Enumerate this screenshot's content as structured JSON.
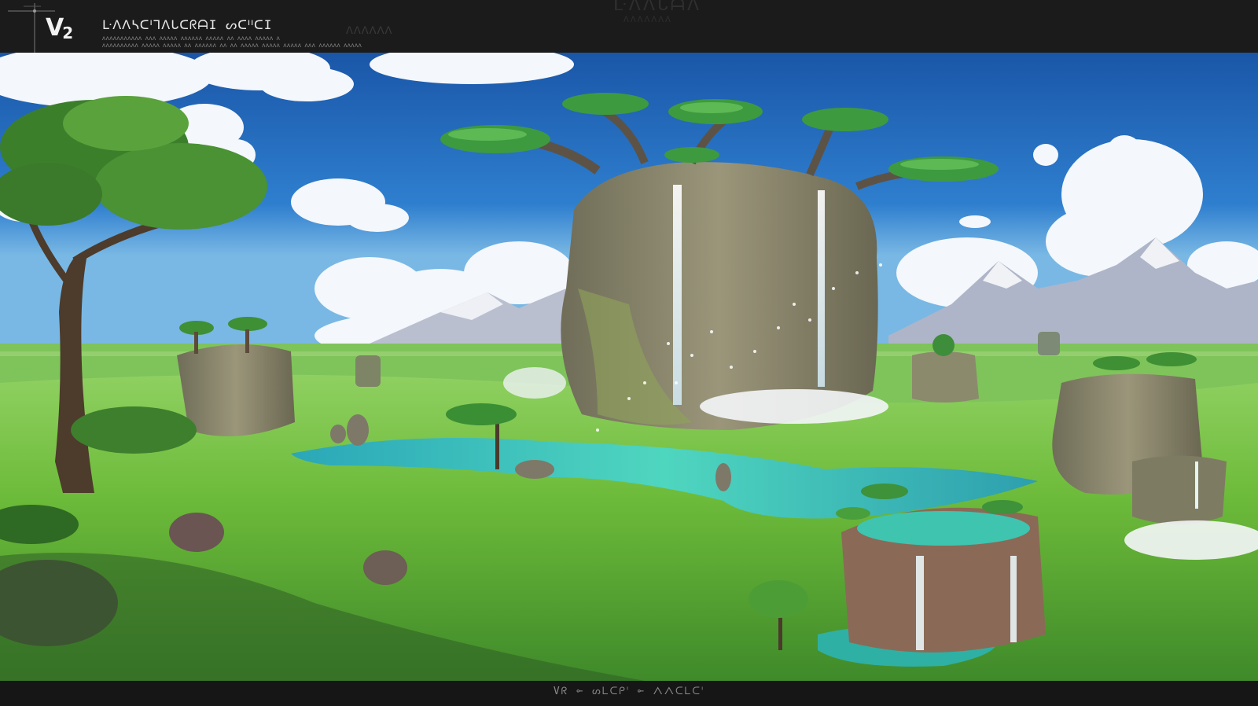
{
  "header": {
    "logo": "V",
    "logo_sub": "2",
    "title": "ᒷᐱᐱᓴᑕᑊᒣᐱᒐᑕᖇᗩI ᔕᑕᑊᑊᑕI",
    "subtitle_line1": "ᐱᐱᐱᐱᐱᐱᐱᐱᐱᐱᐱ ᐱᐱᐱ ᐱᐱᐱᐱᐱ ᐱᐱᐱᐱᐱᐱ ᐱᐱᐱᐱᐱ ᐱᐱ ᐱᐱᐱᐱ ᐱᐱᐱᐱᐱ ᐱ",
    "subtitle_line2": "ᐱᐱᐱᐱᐱᐱᐱᐱᐱᐱ ᐱᐱᐱᐱᐱ ᐱᐱᐱᐱᐱ ᐱᐱ ᐱᐱᐱᐱᐱᐱ ᐱᐱ ᐱᐱ ᐱᐱᐱᐱᐱ ᐱᐱᐱᐱᐱ ᐱᐱᐱᐱᐱ ᐱᐱᐱ ᐱᐱᐱᐱᐱᐱ ᐱᐱᐱᐱᐱ",
    "faint_center": "ᒷᐱᐱᒐᗩᐱ",
    "faint_center_sub": "ᐱᐱᐱᐱᐱᐱᐱ",
    "faint_right": "ᐱᐱᐱᐱᐱᐱ"
  },
  "footer": {
    "caption": "Vᖇ ⟜ ᔕᒪᑕᑭᑊ ⟜ ᐱᐱᑕᒪᑕᑊ"
  },
  "colors": {
    "frame": "#1b1b1c",
    "sky_top": "#1e5cad",
    "sky_low": "#4fa2dc",
    "grass": "#6fbf3a",
    "water": "#35c3b0",
    "rock": "#8a8a6e"
  }
}
